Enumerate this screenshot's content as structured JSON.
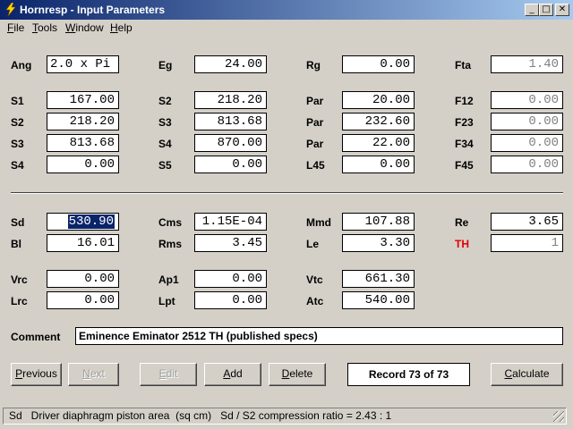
{
  "window": {
    "title": "Hornresp - Input Parameters",
    "minimize": "_",
    "maximize": "□",
    "close": "✕"
  },
  "menu": [
    {
      "key": "F",
      "rest": "ile"
    },
    {
      "key": "T",
      "rest": "ools"
    },
    {
      "key": "W",
      "rest": "indow"
    },
    {
      "key": "H",
      "rest": "elp"
    }
  ],
  "params": {
    "ang": {
      "label": "Ang",
      "value": "2.0 x Pi"
    },
    "eg": {
      "label": "Eg",
      "value": "24.00"
    },
    "rg": {
      "label": "Rg",
      "value": "0.00"
    },
    "fta": {
      "label": "Fta",
      "value": "1.40"
    },
    "s1a": {
      "label": "S1",
      "value": "167.00"
    },
    "s2a": {
      "label": "S2",
      "value": "218.20"
    },
    "s3a": {
      "label": "S3",
      "value": "813.68"
    },
    "s4a": {
      "label": "S4",
      "value": "0.00"
    },
    "s2b": {
      "label": "S2",
      "value": "218.20"
    },
    "s3b": {
      "label": "S3",
      "value": "813.68"
    },
    "s4b": {
      "label": "S4",
      "value": "870.00"
    },
    "s5b": {
      "label": "S5",
      "value": "0.00"
    },
    "par1": {
      "label": "Par",
      "value": "20.00"
    },
    "par2": {
      "label": "Par",
      "value": "232.60"
    },
    "par3": {
      "label": "Par",
      "value": "22.00"
    },
    "l45": {
      "label": "L45",
      "value": "0.00"
    },
    "f12": {
      "label": "F12",
      "value": "0.00"
    },
    "f23": {
      "label": "F23",
      "value": "0.00"
    },
    "f34": {
      "label": "F34",
      "value": "0.00"
    },
    "f45": {
      "label": "F45",
      "value": "0.00"
    },
    "sd": {
      "label": "Sd",
      "value": "530.90"
    },
    "bl": {
      "label": "Bl",
      "value": "16.01"
    },
    "cms": {
      "label": "Cms",
      "value": "1.15E-04"
    },
    "rms": {
      "label": "Rms",
      "value": "3.45"
    },
    "mmd": {
      "label": "Mmd",
      "value": "107.88"
    },
    "le": {
      "label": "Le",
      "value": "3.30"
    },
    "re": {
      "label": "Re",
      "value": "3.65"
    },
    "th": {
      "label": "TH",
      "value": "1"
    },
    "vrc": {
      "label": "Vrc",
      "value": "0.00"
    },
    "lrc": {
      "label": "Lrc",
      "value": "0.00"
    },
    "ap1": {
      "label": "Ap1",
      "value": "0.00"
    },
    "lpt": {
      "label": "Lpt",
      "value": "0.00"
    },
    "vtc": {
      "label": "Vtc",
      "value": "661.30"
    },
    "atc": {
      "label": "Atc",
      "value": "540.00"
    }
  },
  "comment": {
    "label": "Comment",
    "value": "Eminence Eminator 2512 TH (published specs)"
  },
  "buttons": {
    "previous": {
      "key": "P",
      "rest": "revious"
    },
    "next": {
      "key": "N",
      "rest": "ext"
    },
    "edit": {
      "key": "E",
      "rest": "dit"
    },
    "add": {
      "key": "A",
      "rest": "dd"
    },
    "delete": {
      "key": "D",
      "rest": "elete"
    },
    "calculate": {
      "key": "C",
      "rest": "alculate"
    }
  },
  "record": "Record 73 of 73",
  "status": "Sd   Driver diaphragm piston area  (sq cm)   Sd / S2 compression ratio = 2.43 : 1",
  "colors": {
    "titlebar_start": "#0a246a",
    "titlebar_end": "#a6caf0",
    "th_label": "#e00000",
    "face": "#d4d0c8"
  }
}
